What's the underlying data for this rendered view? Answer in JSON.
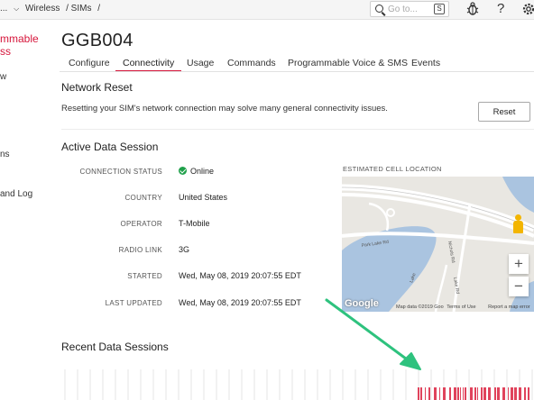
{
  "topbar": {
    "breadcrumbs": [
      "...",
      "Wireless",
      "/ SIMs",
      "/"
    ],
    "search_placeholder": "Go to...",
    "search_shortcut": "S"
  },
  "sidebar": {
    "brand_line1": "mmable",
    "brand_line2": "ss",
    "items": [
      {
        "label": "w"
      },
      {
        "label": "ns"
      },
      {
        "label": "and Log"
      }
    ]
  },
  "sim": {
    "name": "GGB004",
    "tabs": [
      {
        "label": "Configure",
        "active": false
      },
      {
        "label": "Connectivity",
        "active": true
      },
      {
        "label": "Usage",
        "active": false
      },
      {
        "label": "Commands",
        "active": false
      },
      {
        "label": "Programmable Voice & SMS",
        "active": false
      },
      {
        "label": "Events",
        "active": false
      }
    ]
  },
  "network_reset": {
    "title": "Network Reset",
    "description": "Resetting your SIM's network connection may solve many general connectivity issues.",
    "button_label": "Reset"
  },
  "active_session": {
    "title": "Active Data Session",
    "fields": [
      {
        "label": "CONNECTION STATUS",
        "value": "Online",
        "status": "ok"
      },
      {
        "label": "COUNTRY",
        "value": "United States"
      },
      {
        "label": "OPERATOR",
        "value": "T-Mobile"
      },
      {
        "label": "RADIO LINK",
        "value": "3G"
      },
      {
        "label": "STARTED",
        "value": "Wed, May 08, 2019 20:07:55 EDT"
      },
      {
        "label": "LAST UPDATED",
        "value": "Wed, May 08, 2019 20:07:55 EDT"
      }
    ],
    "map": {
      "label": "ESTIMATED CELL LOCATION",
      "road_labels": [
        "Park Lake Rd",
        "Nichols Rd",
        "Lake Rd",
        "Lake"
      ],
      "attribution": "Map data ©2019 Goo",
      "terms": "Terms of Use",
      "report": "Report a map error",
      "logo": "Google",
      "zoom_in": "+",
      "zoom_out": "−"
    }
  },
  "recent_sessions": {
    "title": "Recent Data Sessions"
  },
  "colors": {
    "accent": "#d6163b",
    "online": "#1fa04a",
    "arrow": "#2ec27e",
    "session_bar": "#e0435c"
  }
}
